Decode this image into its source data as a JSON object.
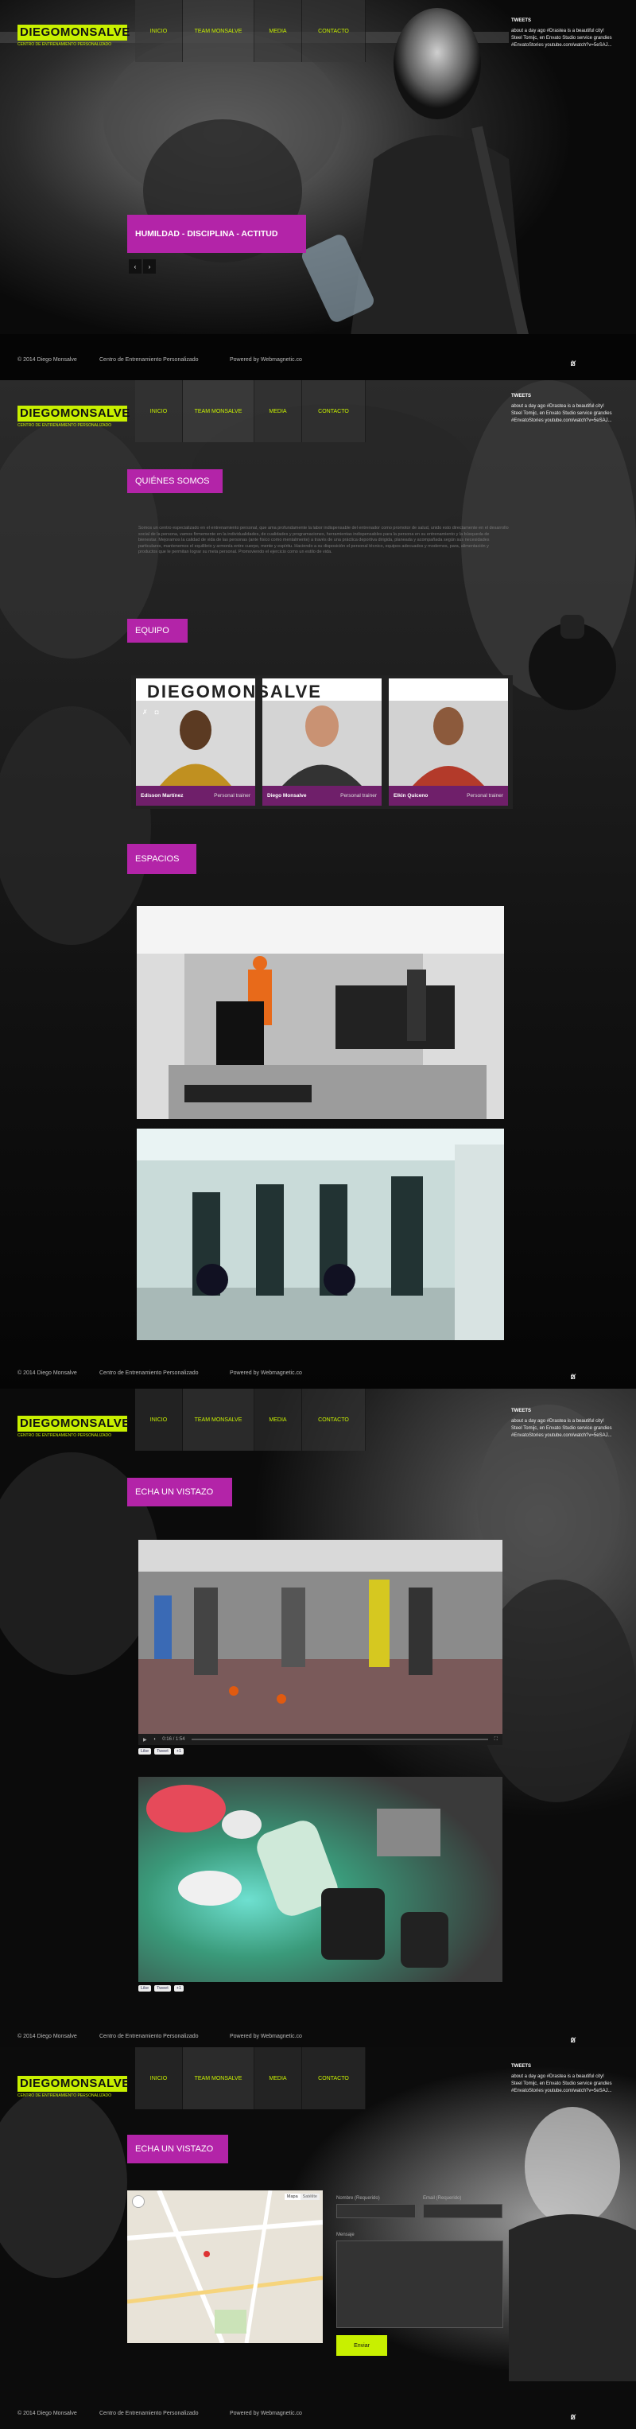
{
  "brand": {
    "logo": "DIEGOMONSALVE",
    "tagline": "CENTRO DE ENTRENAMIENTO PERSONALIZADO",
    "accent": "#c8f000",
    "magenta": "#b324a8"
  },
  "nav": {
    "items": [
      "INICIO",
      "TEAM MONSALVE",
      "MEDIA",
      "CONTACTO"
    ]
  },
  "tweets": {
    "title": "TWEETS",
    "text": "about a day ago #Drastea is a beautiful city! Steel Tomijc, en Envato Studio service grandies #EnvatoStories youtube.com/watch?v=5eSAJ..."
  },
  "footer": {
    "copyright": "© 2014 Diego Monsalve",
    "center": "Centro de Entrenamiento Personalizado",
    "powered": "Powered by Webmagnetic.co",
    "icons": [
      "twitter-icon",
      "instagram-icon",
      "facebook-icon"
    ]
  },
  "hero": {
    "slogan": "HUMILDAD - DISCIPLINA - ACTITUD",
    "prev": "‹",
    "next": "›"
  },
  "about": {
    "title": "QUIÉNES SOMOS",
    "body": "Somos un centro especializado en el entrenamiento personal, que ama profundamente la labor indispensable del entrenador como promotor de salud, unido esto directamente en el desarrollo social de la persona, vamos firmemente en la individualidades, de cualidades y programaciones, herramientas indispensables para la persona en su entrenamiento y la búsqueda de bienestar. Mejoramos la calidad de vida de las personas (ante físico como mentalmente) a través de una práctica deportiva dirigida, planeada y acompañada según sus necesidades particulares, mantenemos el equilibrio y armonía entre cuerpo, mente y espíritu. Haciendo a su disposición el personal técnico, equipos adecuados y modernos, para, alimentación y productos que le permitan lograr su meta personal. Promoviendo el ejercicio como un estilo de vida."
  },
  "team": {
    "title": "EQUIPO",
    "members": [
      {
        "name": "Edisson Martínez",
        "role": "Personal trainer"
      },
      {
        "name": "Diego Monsalve",
        "role": "Personal trainer"
      },
      {
        "name": "Elkin Quiceno",
        "role": "Personal trainer"
      }
    ],
    "wall_text": "DIEGOMONSALVE"
  },
  "spaces": {
    "title": "ESPACIOS"
  },
  "media": {
    "title": "ECHA UN VISTAZO",
    "video_time": "0:16 / 1:54",
    "share": [
      "Like",
      "Tweet",
      "+1"
    ]
  },
  "contact": {
    "title": "ECHA UN VISTAZO",
    "map_tabs": [
      "Mapa",
      "Satélite"
    ],
    "name_label": "Nombre (Requerido)",
    "email_label": "Email (Requerido)",
    "message_label": "Mensaje",
    "send": "Enviar"
  }
}
